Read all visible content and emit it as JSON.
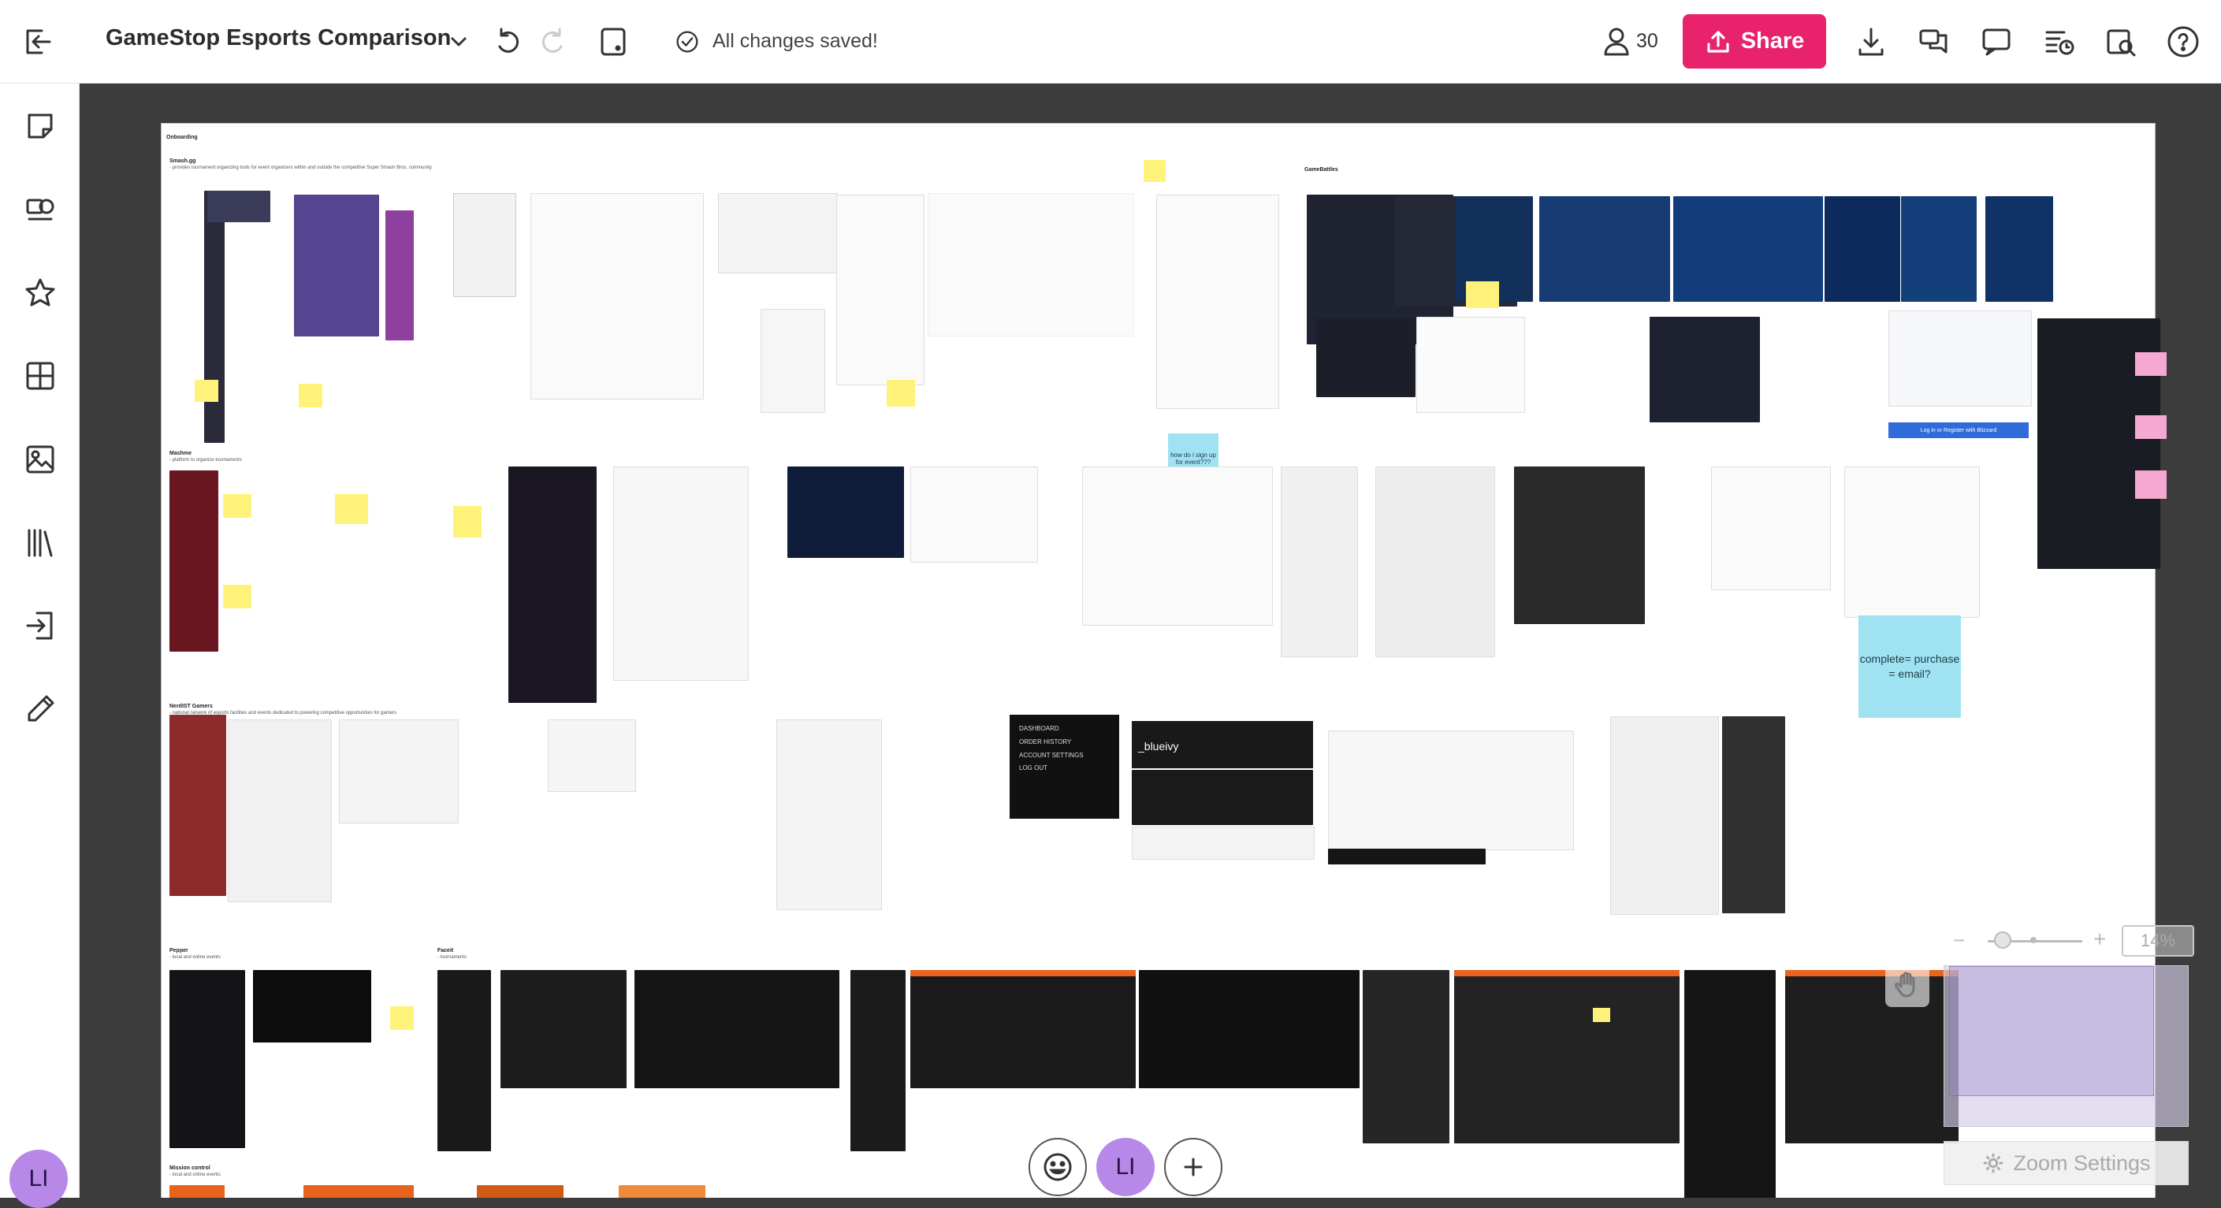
{
  "app": {
    "board_title": "GameStop Esports Comparison",
    "save_status": "All changes saved!",
    "collaborator_count": "30",
    "share_label": "Share",
    "user_initials": "LI"
  },
  "sidebar": {
    "items": [
      {
        "icon": "exit-icon"
      },
      {
        "icon": "sticky-note-icon"
      },
      {
        "icon": "templates-icon"
      },
      {
        "icon": "favorites-star-icon"
      },
      {
        "icon": "grid-icon"
      },
      {
        "icon": "image-icon"
      },
      {
        "icon": "library-icon"
      },
      {
        "icon": "import-icon"
      },
      {
        "icon": "pen-icon"
      }
    ]
  },
  "toolbar_icons": [
    "undo-icon",
    "redo-icon",
    "frame-icon",
    "download-icon",
    "comments-icon",
    "chat-icon",
    "activity-icon",
    "search-icon",
    "help-icon"
  ],
  "board": {
    "sections": [
      {
        "title": "Onboarding"
      },
      {
        "title": "Smash.gg",
        "desc": "- provides tournament organizing tools for event organizers within and outside the competitive Super Smash Bros. community"
      },
      {
        "title": "GameBattles"
      },
      {
        "title": "Mashme",
        "desc": "- platform to organize tournaments"
      },
      {
        "title": "NerdIST Gamers",
        "desc": "- national network of esports facilities and events dedicated to powering competitive opportunities for gamers"
      },
      {
        "title": "Pepper",
        "desc": "- local and online events"
      },
      {
        "title": "Faceit",
        "desc": "- tournaments"
      },
      {
        "title": "Mission control",
        "desc": "- local and online events"
      }
    ],
    "notes": {
      "complete_purchase": "complete= purchase = email?",
      "how_sign_up": "how do i sign up for event???",
      "login_blizzard": "Log in or Register with Blizzard",
      "blueivy": "_blueivy",
      "account_menu": [
        "DASHBOARD",
        "ORDER HISTORY",
        "ACCOUNT SETTINGS",
        "LOG OUT"
      ]
    }
  },
  "presence_bar": {
    "avatar_initials": "LI"
  },
  "zoom": {
    "value": "14%",
    "level": 0.14,
    "settings_label": "Zoom Settings"
  },
  "colors": {
    "accent": "#e8226b",
    "canvas_bg": "#3c3c3c",
    "avatar": "#b788e8"
  }
}
